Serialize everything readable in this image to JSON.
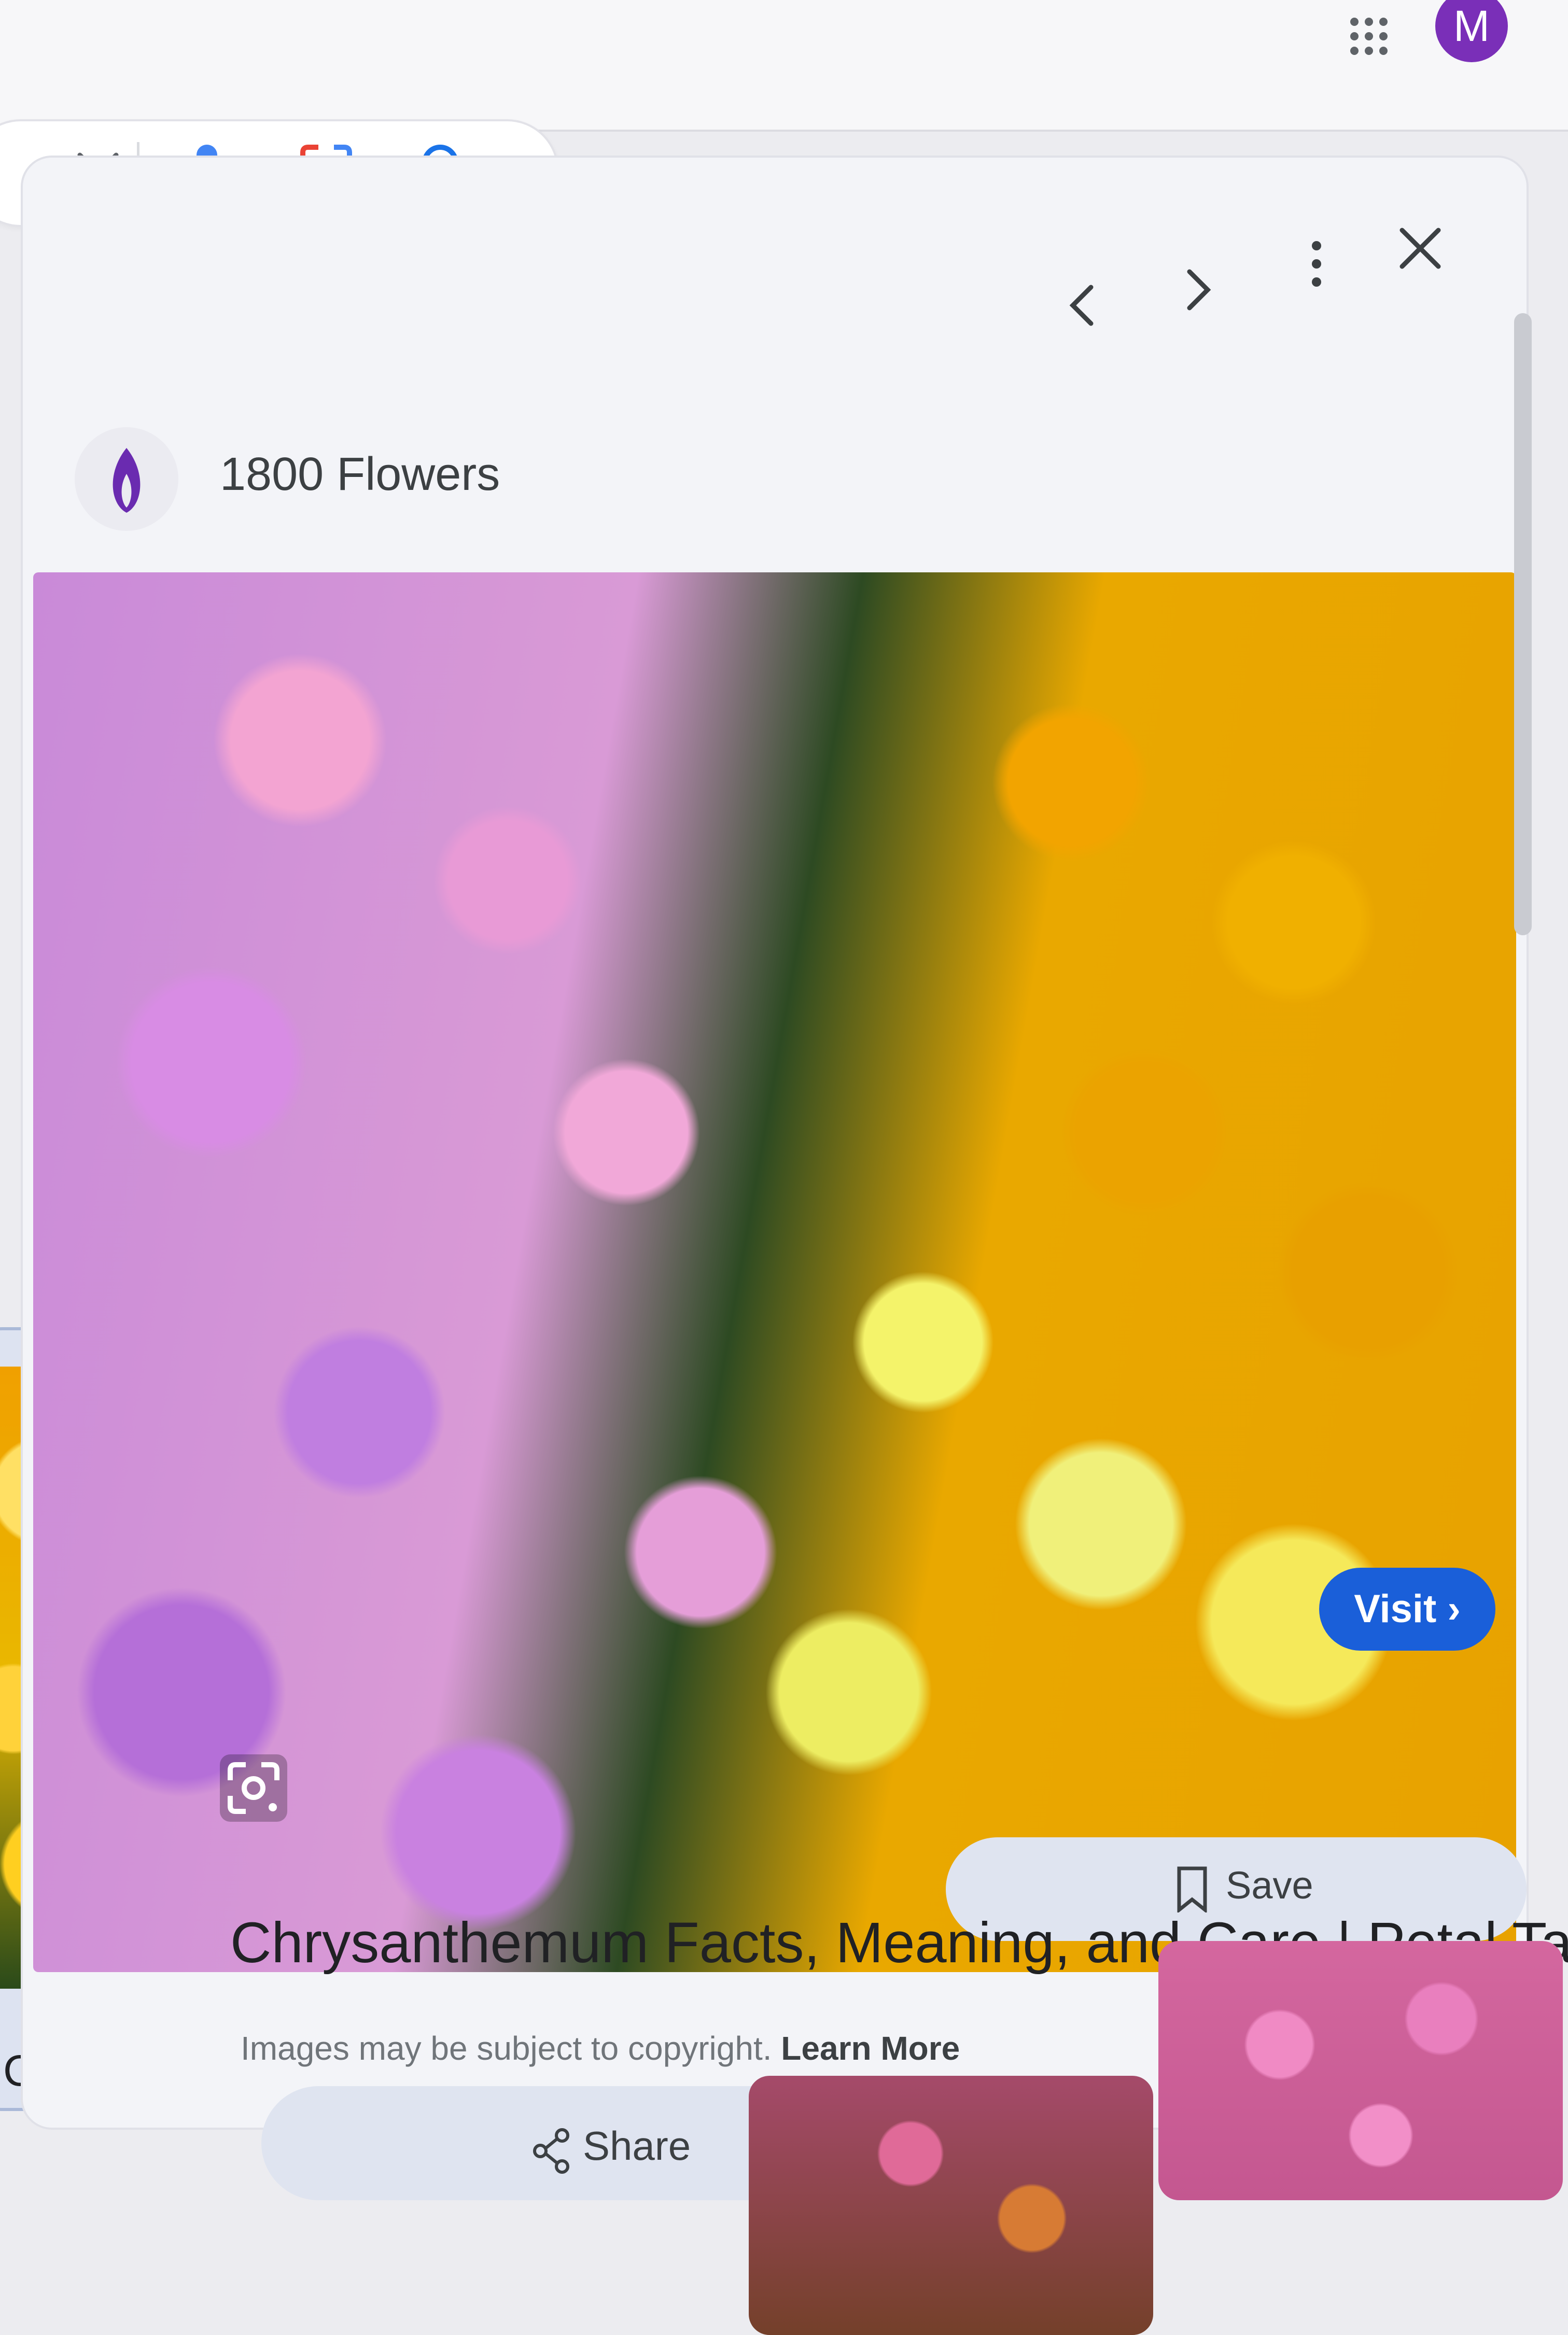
{
  "header": {
    "apps_icon": "apps-grid-icon",
    "avatar_initial": "M",
    "avatar_color": "#7a2fb8"
  },
  "search": {
    "clear_icon": "close-icon",
    "mic_icon": "microphone-icon",
    "lens_icon": "google-lens-icon",
    "search_icon": "search-icon"
  },
  "viewer": {
    "source_name": "1800 Flowers",
    "source_logo": "flame-logo-icon",
    "nav": {
      "prev_icon": "chevron-left-icon",
      "next_icon": "chevron-right-icon",
      "more_icon": "more-vert-icon",
      "close_icon": "close-icon"
    },
    "visit_label": "Visit ›",
    "title": "Chrysanthemum Facts, Meaning, and Care | Petal Talk",
    "copyright_text": "Images may be subject to copyright.",
    "learn_more": "Learn More",
    "save_label": "Save",
    "share_label": "Share",
    "accent_color": "#1a5fd9"
  },
  "left_result": {
    "caption": "Ca..."
  }
}
